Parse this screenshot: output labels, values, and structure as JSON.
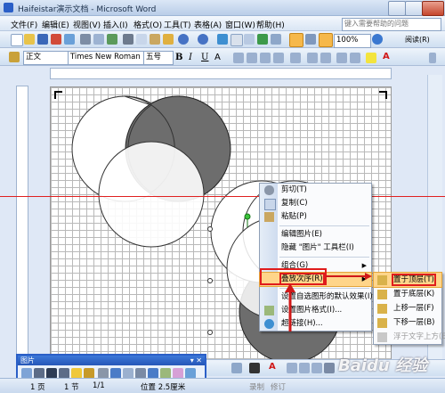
{
  "window": {
    "title": "Haifeistar演示文档 - Microsoft Word"
  },
  "menubar": {
    "items": [
      "文件(F)",
      "编辑(E)",
      "视图(V)",
      "插入(I)",
      "格式(O)",
      "工具(T)",
      "表格(A)",
      "窗口(W)",
      "帮助(H)"
    ],
    "help_placeholder": "键入需要帮助的问题"
  },
  "toolbar": {
    "zoom": "100%",
    "read_label": "阅读(R)"
  },
  "format_bar": {
    "style": "正文",
    "font": "Times New Roman",
    "size": "五号"
  },
  "context_menu": {
    "items": [
      {
        "label": "剪切(T)",
        "icon": "scissors-icon"
      },
      {
        "label": "复制(C)",
        "icon": "copy-icon"
      },
      {
        "label": "粘贴(P)",
        "icon": "paste-icon"
      },
      {
        "label": "编辑图片(E)",
        "icon": ""
      },
      {
        "label": "隐藏 \"图片\" 工具栏(I)",
        "icon": ""
      },
      {
        "label": "组合(G)",
        "icon": ""
      },
      {
        "label": "叠放次序(R)",
        "icon": ""
      },
      {
        "label": "设置自选图形的默认效果(I)",
        "icon": ""
      },
      {
        "label": "设置图片格式(I)...",
        "icon": "format-picture-icon"
      },
      {
        "label": "超链接(H)...",
        "icon": "hyperlink-icon"
      }
    ]
  },
  "submenu": {
    "items": [
      {
        "label": "置于顶层(T)",
        "enabled": true
      },
      {
        "label": "置于底层(K)",
        "enabled": true
      },
      {
        "label": "上移一层(F)",
        "enabled": true
      },
      {
        "label": "下移一层(B)",
        "enabled": true
      },
      {
        "label": "浮于文字上方(E)",
        "enabled": false
      }
    ]
  },
  "picture_toolbar": {
    "title": "图片"
  },
  "statusbar": {
    "page": "1 页",
    "section": "1 节",
    "pages": "1/1",
    "position": "位置 2.5厘米",
    "rec": "录制",
    "mark": "修订"
  },
  "colors": {
    "accent": "#2b5fc7",
    "highlight": "#ffd58a",
    "redline": "#e02020",
    "arrow": "#d01818"
  }
}
